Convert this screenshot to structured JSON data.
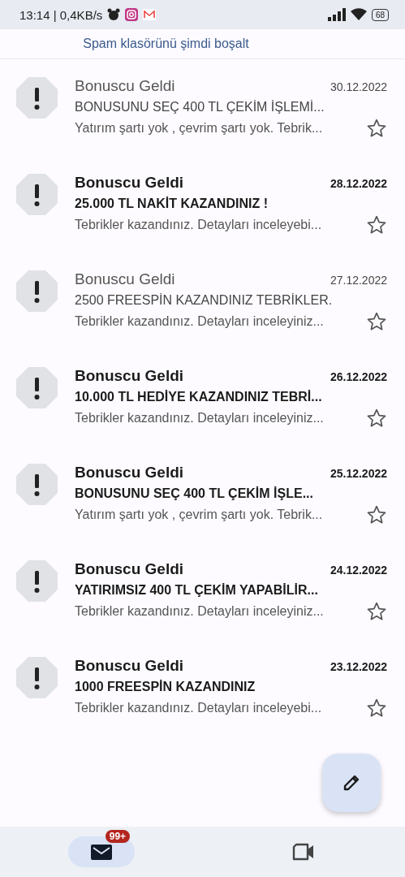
{
  "status_bar": {
    "time": "13:14 | 0,4KB/s",
    "battery": "68"
  },
  "banner": {
    "link": "Spam klasörünü şimdi boşalt"
  },
  "emails": [
    {
      "sender": "Bonuscu Geldi",
      "date": "30.12.2022",
      "subject": "BONUSUNU SEÇ 400 TL ÇEKİM İŞLEMİ...",
      "snippet": "Yatırım şartı yok , çevrim şartı yok. Tebrik...",
      "unread": false,
      "starred": false
    },
    {
      "sender": "Bonuscu Geldi",
      "date": "28.12.2022",
      "subject": "25.000 TL NAKİT KAZANDINIZ !",
      "snippet": "Tebrikler kazandınız. Detayları inceleyebi...",
      "unread": true,
      "starred": false
    },
    {
      "sender": "Bonuscu Geldi",
      "date": "27.12.2022",
      "subject": "2500 FREESPİN KAZANDINIZ TEBRİKLER.",
      "snippet": "Tebrikler kazandınız. Detayları inceleyiniz...",
      "unread": false,
      "starred": false
    },
    {
      "sender": "Bonuscu Geldi",
      "date": "26.12.2022",
      "subject": "10.000 TL HEDİYE KAZANDINIZ TEBRİ...",
      "snippet": "Tebrikler kazandınız. Detayları inceleyiniz...",
      "unread": true,
      "starred": false
    },
    {
      "sender": "Bonuscu Geldi",
      "date": "25.12.2022",
      "subject": "BONUSUNU SEÇ 400 TL ÇEKİM İŞLE...",
      "snippet": "Yatırım şartı yok , çevrim şartı yok. Tebrik...",
      "unread": true,
      "starred": false
    },
    {
      "sender": "Bonuscu Geldi",
      "date": "24.12.2022",
      "subject": "YATIRIMSIZ 400 TL ÇEKİM YAPABİLİR...",
      "snippet": "Tebrikler kazandınız. Detayları inceleyiniz...",
      "unread": true,
      "starred": false
    },
    {
      "sender": "Bonuscu Geldi",
      "date": "23.12.2022",
      "subject": "1000 FREESPİN KAZANDINIZ",
      "snippet": "Tebrikler kazandınız. Detayları inceleyebi...",
      "unread": true,
      "starred": false
    }
  ],
  "bottom_nav": {
    "items": [
      {
        "kind": "mail",
        "selected": true,
        "badge": "99+"
      },
      {
        "kind": "video",
        "selected": false
      }
    ]
  }
}
